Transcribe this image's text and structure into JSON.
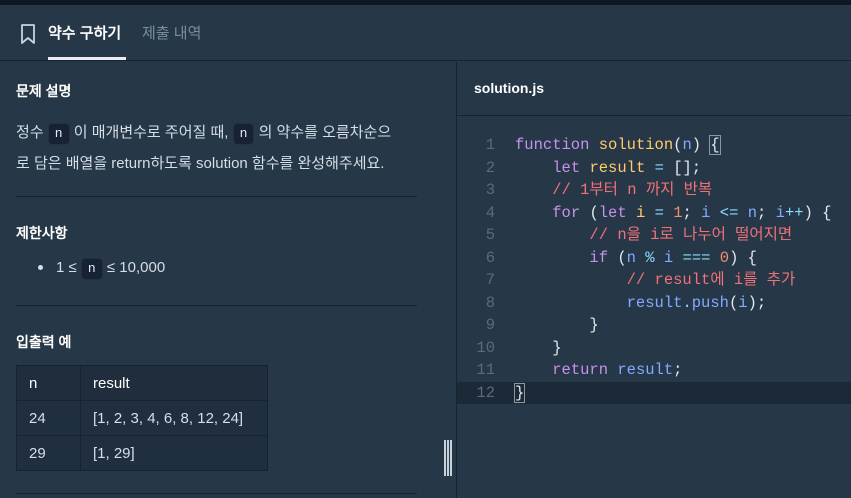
{
  "tabs": {
    "active_label": "약수 구하기",
    "inactive_label": "제출 내역"
  },
  "problem": {
    "title": "문제 설명",
    "desc_part1": "정수",
    "desc_var1": "n",
    "desc_part2": "이 매개변수로 주어질 때,",
    "desc_var2": "n",
    "desc_part3": "의 약수를 오름차순으",
    "desc_line2": "로 담은 배열을 return하도록 solution 함수를 완성해주세요."
  },
  "constraints": {
    "title": "제한사항",
    "item_prefix": "1 ≤",
    "item_var": "n",
    "item_suffix": "≤ 10,000"
  },
  "examples": {
    "title": "입출력 예",
    "headers": [
      "n",
      "result"
    ],
    "rows": [
      [
        "24",
        "[1, 2, 3, 4, 6, 8, 12, 24]"
      ],
      [
        "29",
        "[1, 29]"
      ]
    ]
  },
  "editor": {
    "file_name": "solution.js",
    "line_numbers": [
      "1",
      "2",
      "3",
      "4",
      "5",
      "6",
      "7",
      "8",
      "9",
      "10",
      "11",
      "12"
    ],
    "comments": {
      "c3": "// 1부터 n 까지 반복",
      "c5": "// n을 i로 나누어 떨어지면",
      "c7": "// result에 i를 추가"
    }
  },
  "colors": {
    "background": "#263747",
    "panel_border": "#172334",
    "keyword": "#c792ea",
    "function": "#ffcb6b",
    "variable": "#82aaff",
    "number": "#f78c6c",
    "comment": "#f07178"
  }
}
